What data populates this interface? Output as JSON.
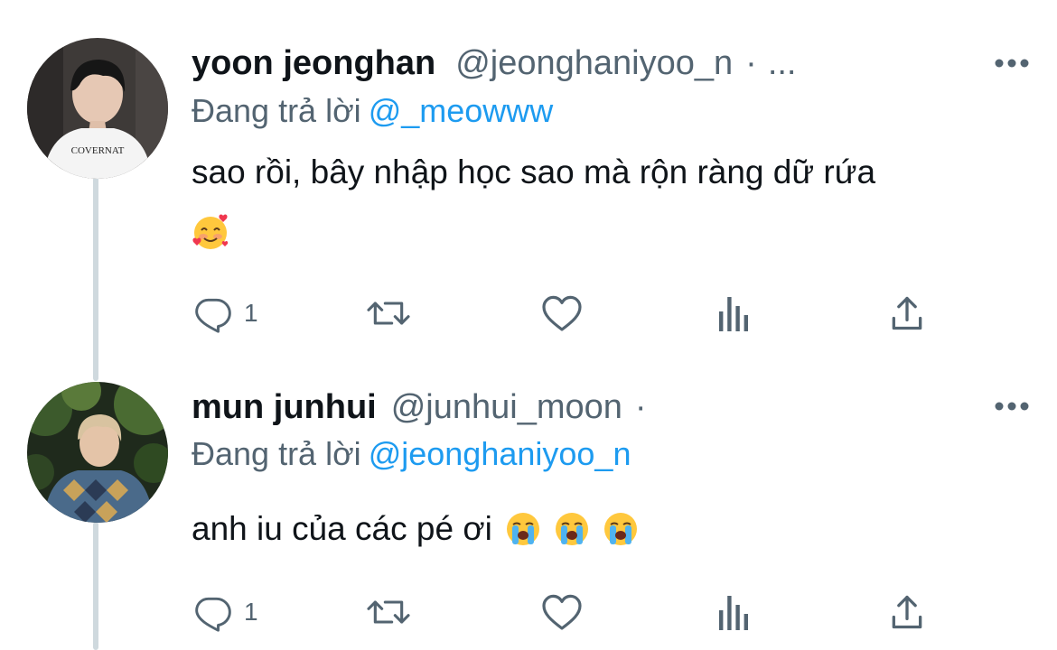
{
  "tweets": [
    {
      "name": "yoon jeonghan",
      "handle": "@jeonghaniyoo_n",
      "separator": "·",
      "trail": "...",
      "replying_prefix": "Đang trả lời",
      "replying_to": "@_meowww",
      "text": "sao rồi, bây nhập học sao mà rộn ràng dữ rứa",
      "emojis": [
        "smiling-face-with-hearts"
      ],
      "reply_count": "1",
      "avatar_shirt_text": "COVERNAT"
    },
    {
      "name": "mun junhui",
      "handle": "@junhui_moon",
      "separator": "·",
      "replying_prefix": "Đang trả lời",
      "replying_to": "@jeonghaniyoo_n",
      "text": "anh iu của các pé ơi",
      "emojis": [
        "loudly-crying-face",
        "loudly-crying-face",
        "loudly-crying-face"
      ],
      "reply_count": "1"
    }
  ],
  "colors": {
    "mention": "#1d9bf0",
    "secondary_text": "#536471",
    "icon": "#536471",
    "thread_line": "#cfd9de"
  }
}
